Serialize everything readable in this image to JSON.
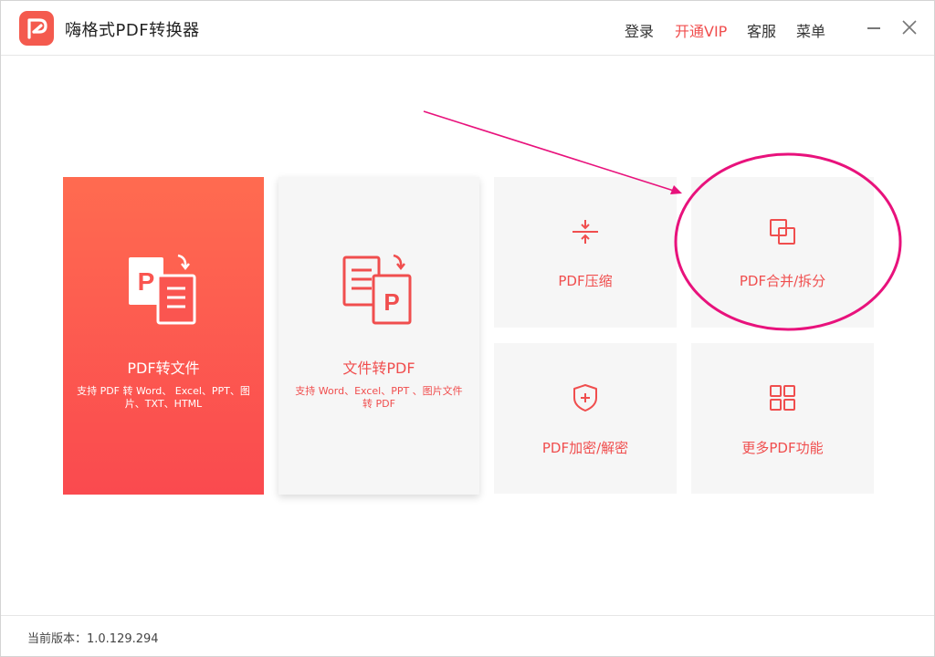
{
  "app": {
    "title": "嗨格式PDF转换器"
  },
  "nav": {
    "login": "登录",
    "vip": "开通VIP",
    "service": "客服",
    "menu": "菜单"
  },
  "window_controls": {
    "minimize_icon": "minimize-icon",
    "close_icon": "close-icon"
  },
  "cards": {
    "pdf_to_file": {
      "title": "PDF转文件",
      "desc": "支持 PDF 转 Word、 Excel、PPT、图片、TXT、HTML",
      "icon": "pdf-to-file-icon"
    },
    "file_to_pdf": {
      "title": "文件转PDF",
      "desc": "支持 Word、Excel、PPT 、图片文件转 PDF",
      "icon": "file-to-pdf-icon"
    },
    "compress": {
      "title": "PDF压缩",
      "icon": "compress-icon"
    },
    "merge_split": {
      "title": "PDF合并/拆分",
      "icon": "merge-icon"
    },
    "encrypt": {
      "title": "PDF加密/解密",
      "icon": "shield-icon"
    },
    "more": {
      "title": "更多PDF功能",
      "icon": "grid-icon"
    }
  },
  "footer": {
    "version": "当前版本：1.0.129.294"
  },
  "colors": {
    "accent": "#f04e4e",
    "primary_card_top": "#ff6b50",
    "primary_card_bottom": "#fa4a4f",
    "card_bg": "#f6f6f6",
    "annotation": "#e8127c"
  }
}
